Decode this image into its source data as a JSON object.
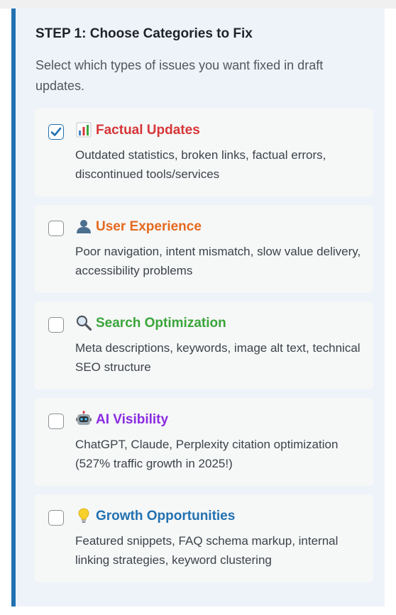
{
  "step": {
    "title": "STEP 1: Choose Categories to Fix",
    "description": "Select which types of issues you want fixed in draft updates."
  },
  "categories": [
    {
      "title": "Factual Updates",
      "description": "Outdated statistics, broken links, factual errors, discontinued tools/services",
      "checked": true,
      "icon": "bar-chart-icon",
      "color": "#d63638"
    },
    {
      "title": "User Experience",
      "description": "Poor navigation, intent mismatch, slow value delivery, accessibility problems",
      "checked": false,
      "icon": "user-silhouette-icon",
      "color": "#e56a1e"
    },
    {
      "title": "Search Optimization",
      "description": "Meta descriptions, keywords, image alt text, technical SEO structure",
      "checked": false,
      "icon": "magnifier-icon",
      "color": "#3aa53a"
    },
    {
      "title": "AI Visibility",
      "description": "ChatGPT, Claude, Perplexity citation optimization (527% traffic growth in 2025!)",
      "checked": false,
      "icon": "robot-icon",
      "color": "#8a2be2"
    },
    {
      "title": "Growth Opportunities",
      "description": "Featured snippets, FAQ schema markup, internal linking strategies, keyword clustering",
      "checked": false,
      "icon": "light-bulb-icon",
      "color": "#2271b1"
    }
  ],
  "colors": {
    "accent": "#2271b1",
    "panel_background": "#eef3fa",
    "card_background": "#f6f7f7"
  }
}
